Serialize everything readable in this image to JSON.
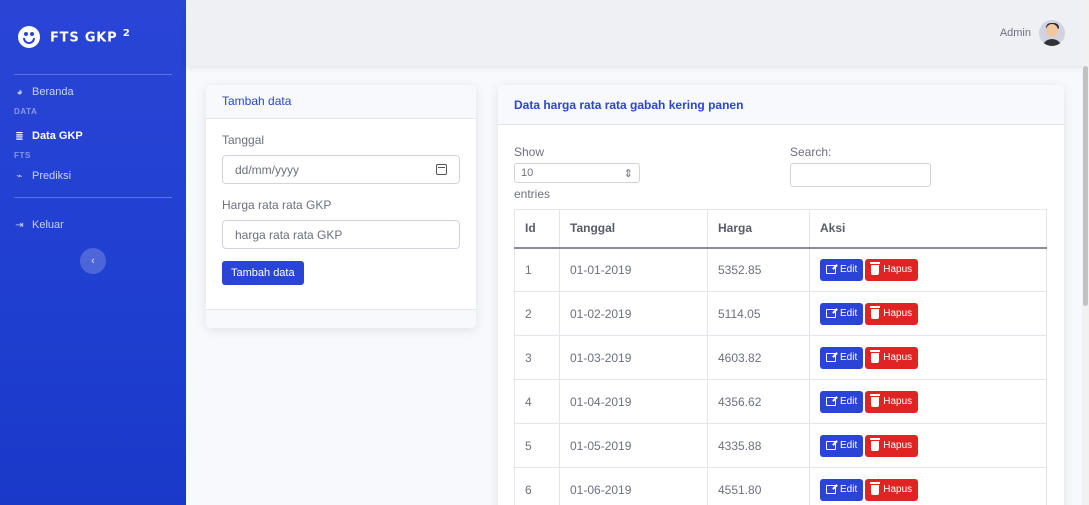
{
  "sidebar": {
    "brand": "FTS GKP",
    "brand_sup": "2",
    "items": [
      {
        "label": "Beranda",
        "icon": "tachometer-icon"
      },
      {
        "heading": "DATA"
      },
      {
        "label": "Data GKP",
        "icon": "database-icon",
        "active": true
      },
      {
        "heading": "FTS"
      },
      {
        "label": "Prediksi",
        "icon": "chart-line-icon"
      },
      {
        "label": "Keluar",
        "icon": "sign-out-icon"
      }
    ]
  },
  "topbar": {
    "user": "Admin"
  },
  "form": {
    "title": "Tambah data",
    "date_label": "Tanggal",
    "date_placeholder": "dd/mm/yyyy",
    "price_label": "Harga rata rata GKP",
    "price_placeholder": "harga rata rata GKP",
    "submit": "Tambah data"
  },
  "table_card": {
    "title": "Data harga rata rata gabah kering panen",
    "show": "Show",
    "entries_value": "10",
    "entries": "entries",
    "search_label": "Search:",
    "columns": [
      "Id",
      "Tanggal",
      "Harga",
      "Aksi"
    ],
    "rows": [
      {
        "id": "1",
        "tanggal": "01-01-2019",
        "harga": "5352.85"
      },
      {
        "id": "2",
        "tanggal": "01-02-2019",
        "harga": "5114.05"
      },
      {
        "id": "3",
        "tanggal": "01-03-2019",
        "harga": "4603.82"
      },
      {
        "id": "4",
        "tanggal": "01-04-2019",
        "harga": "4356.62"
      },
      {
        "id": "5",
        "tanggal": "01-05-2019",
        "harga": "4335.88"
      },
      {
        "id": "6",
        "tanggal": "01-06-2019",
        "harga": "4551.80"
      }
    ],
    "edit_label": "Edit",
    "delete_label": "Hapus"
  },
  "colors": {
    "primary": "#2a45d6",
    "danger": "#e02424"
  }
}
